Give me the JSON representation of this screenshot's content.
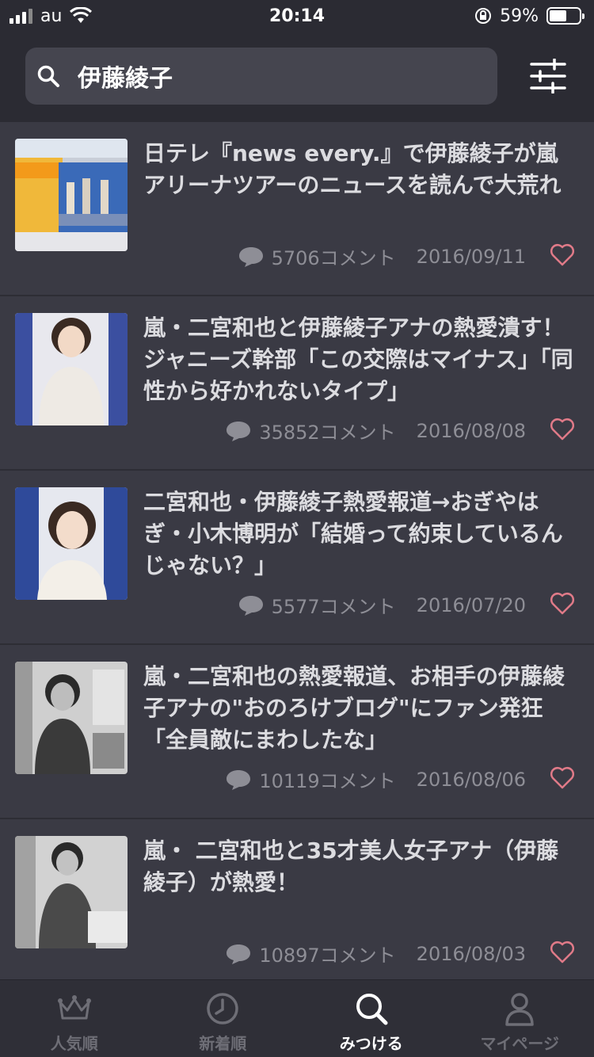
{
  "status_bar": {
    "carrier": "au",
    "time": "20:14",
    "battery": "59%"
  },
  "search": {
    "query": "伊藤綾子"
  },
  "articles": [
    {
      "title": "日テレ『news every.』で伊藤綾子が嵐アリーナツアーのニュースを読んで大荒れ",
      "comments": "5706コメント",
      "date": "2016/09/11"
    },
    {
      "title": "嵐・二宮和也と伊藤綾子アナの熱愛潰す！ジャニーズ幹部「この交際はマイナス」「同性から好かれないタイプ」",
      "comments": "35852コメント",
      "date": "2016/08/08"
    },
    {
      "title": "二宮和也・伊藤綾子熱愛報道→おぎやはぎ・小木博明が「結婚って約束しているんじゃない？」",
      "comments": "5577コメント",
      "date": "2016/07/20"
    },
    {
      "title": "嵐・二宮和也の熱愛報道、お相手の伊藤綾子アナの\"おのろけブログ\"にファン発狂「全員敵にまわしたな」",
      "comments": "10119コメント",
      "date": "2016/08/06"
    },
    {
      "title": "嵐・ 二宮和也と35才美人女子アナ（伊藤綾子）が熱愛！",
      "comments": "10897コメント",
      "date": "2016/08/03"
    }
  ],
  "tabs": [
    {
      "label": "人気順",
      "icon": "crown-icon"
    },
    {
      "label": "新着順",
      "icon": "clock-icon"
    },
    {
      "label": "みつける",
      "icon": "search-icon",
      "active": true
    },
    {
      "label": "マイページ",
      "icon": "person-icon"
    }
  ],
  "colors": {
    "background": "#3a3a44",
    "header": "#2b2b33",
    "heart": "#e07a88"
  }
}
